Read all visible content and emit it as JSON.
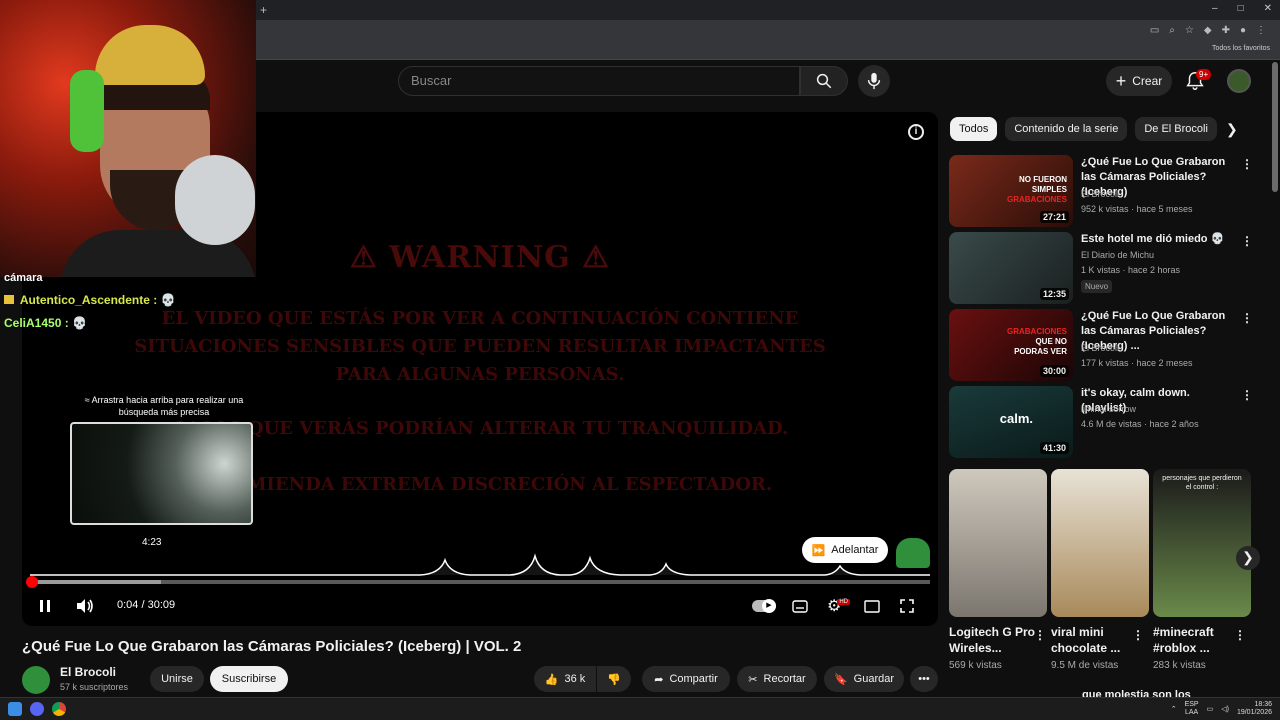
{
  "browser": {
    "new_tab": "+",
    "window_controls": [
      "–",
      "□",
      "✕"
    ],
    "bookmark_folder": "Todos los favoritos"
  },
  "header": {
    "search_placeholder": "Buscar",
    "create_label": "Crear",
    "notifications_badge": "9+"
  },
  "player": {
    "warning_title": "⚠ WARNING ⚠",
    "warning_lines": [
      "EL VIDEO QUE ESTÁS POR VER A CONTINUACIÓN CONTIENE",
      "SITUACIONES SENSIBLES QUE PUEDEN RESULTAR IMPACTANTES",
      "PARA ALGUNAS PERSONAS.",
      "CASOS QUE VERÁS PODRÍAN ALTERAR TU TRANQUILIDAD.",
      "RECOMIENDA EXTREMA DISCRECIÓN AL ESPECTADOR."
    ],
    "drag_hint": "≈ Arrastra hacia arriba para realizar una búsqueda más precisa",
    "preview_time": "4:23",
    "skip_label": "Adelantar",
    "current_time": "0:04 / 30:09",
    "progress_played_fraction": 0.004,
    "progress_buffered_fraction": 0.145,
    "settings_badge": "HD"
  },
  "video": {
    "title": "¿Qué Fue Lo Que Grabaron las Cámaras Policiales? (Iceberg) | VOL. 2",
    "channel": "El Brocoli",
    "subscribers": "57 k suscriptores",
    "join_label": "Unirse",
    "subscribe_label": "Suscribirse",
    "likes": "36 k",
    "share_label": "Compartir",
    "clip_label": "Recortar",
    "save_label": "Guardar",
    "more": "•••"
  },
  "chips": [
    "Todos",
    "Contenido de la serie",
    "De El Brocoli"
  ],
  "recommendations": [
    {
      "title": "¿Qué Fue Lo Que Grabaron las Cámaras Policiales? (Iceberg)",
      "channel": "El Brocoli",
      "meta": "952 k vistas · hace 5 meses",
      "duration": "27:21",
      "overlay": [
        "NO FUERON",
        "SIMPLES",
        "GRABACIONES"
      ]
    },
    {
      "title": "Este hotel me dió miedo 💀",
      "channel": "El Diario de Michu",
      "meta": "1 K vistas · hace 2 horas",
      "duration": "12:35",
      "badge": "Nuevo"
    },
    {
      "title": "¿Qué Fue Lo Que Grabaron las Cámaras Policiales? (Iceberg) ...",
      "channel": "El Brocoli",
      "meta": "177 k vistas · hace 2 meses",
      "duration": "30:00",
      "overlay": [
        "GRABACIONES",
        "QUE NO",
        "PODRAS VER"
      ]
    },
    {
      "title": "it's okay, calm down. (playlist)",
      "channel": "liminal sorrow",
      "meta": "4.6 M de vistas · hace 2 años",
      "duration": "41:30",
      "overlay": [
        "calm."
      ]
    }
  ],
  "shorts": [
    {
      "title": "Logitech G Pro Wireles...",
      "views": "569 k vistas"
    },
    {
      "title": "viral mini chocolate ...",
      "views": "9.5 M de vistas"
    },
    {
      "title": "#minecraft #roblox ...",
      "views": "283 k vistas",
      "overlay": "personajes que perdieron el control :"
    }
  ],
  "partial_next": "que molestia son los",
  "chat": [
    {
      "user": "cámara",
      "msg": ""
    },
    {
      "user": "Autentico_Ascendente :",
      "msg": "💀",
      "color": "#d8e84a"
    },
    {
      "user": "CeliA1450 :",
      "msg": "💀",
      "color": "#a8ff6a"
    }
  ],
  "taskbar": {
    "lang": "ESP",
    "lang2": "LAA",
    "clock_time": "18:36",
    "clock_date": "19/01/2026"
  },
  "colors": {
    "accent": "#ff0000",
    "bg": "#0f0f0f",
    "chip_active": "#f1f1f1"
  }
}
